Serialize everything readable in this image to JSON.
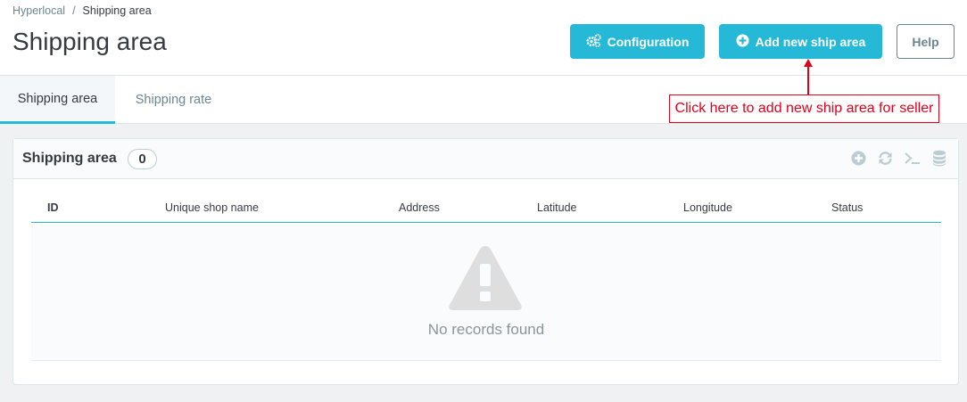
{
  "breadcrumb": {
    "parent": "Hyperlocal",
    "separator": "/",
    "current": "Shipping area"
  },
  "header": {
    "title": "Shipping area",
    "buttons": {
      "configuration": "Configuration",
      "add_new": "Add new ship area",
      "help": "Help"
    }
  },
  "tabs": [
    {
      "label": "Shipping area",
      "active": true
    },
    {
      "label": "Shipping rate",
      "active": false
    }
  ],
  "annotation": {
    "text": "Click here to add new ship area for seller"
  },
  "panel": {
    "title": "Shipping area",
    "count": "0",
    "toolbar_icons": [
      "add-circle-icon",
      "refresh-icon",
      "sql-terminal-icon",
      "database-icon"
    ],
    "columns": [
      "ID",
      "Unique shop name",
      "Address",
      "Latitude",
      "Longitude",
      "Status"
    ],
    "rows": [],
    "empty_message": "No records found"
  },
  "colors": {
    "accent": "#25b9d7",
    "annotation_red": "#e0001a",
    "text_dark": "#363a41",
    "muted": "#6c868e"
  }
}
